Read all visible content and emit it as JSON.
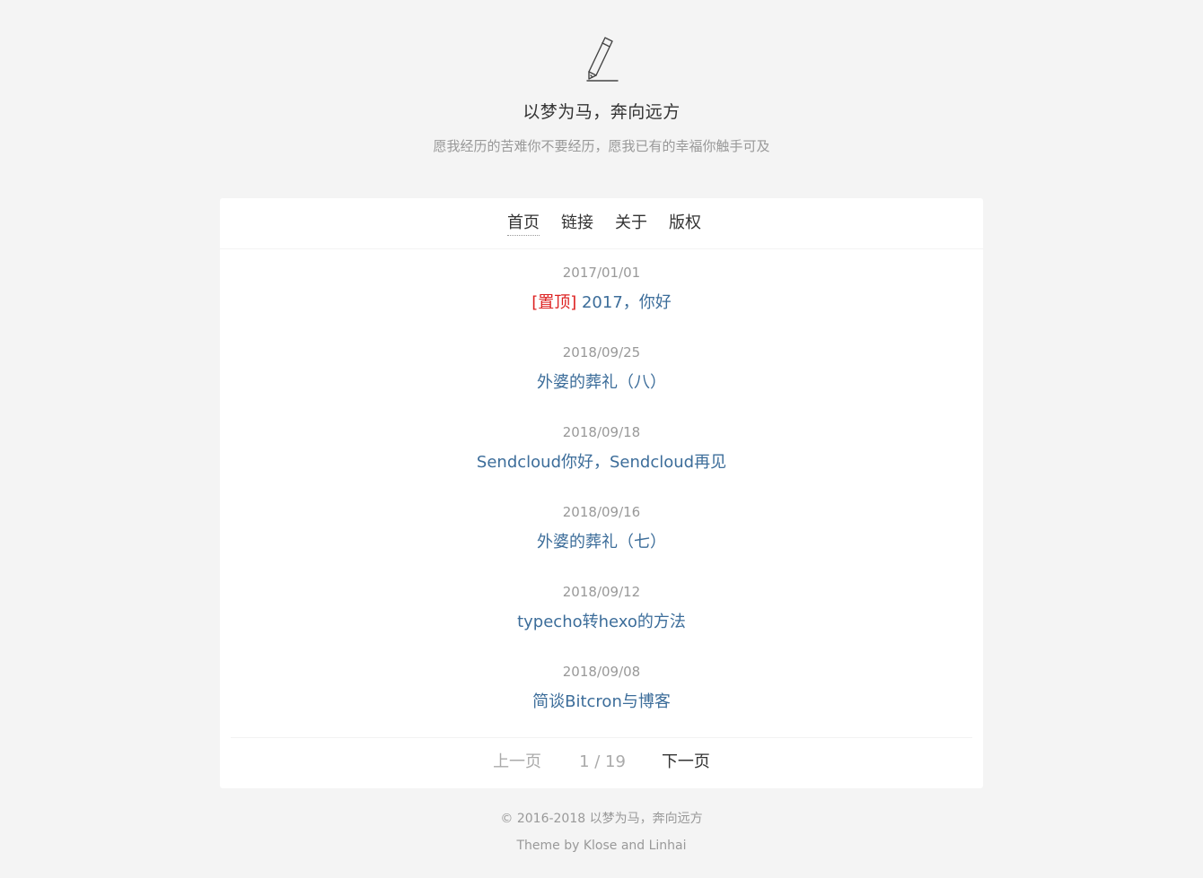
{
  "site": {
    "title": "以梦为马，奔向远方",
    "subtitle": "愿我经历的苦难你不要经历，愿我已有的幸福你触手可及"
  },
  "nav": {
    "items": [
      {
        "label": "首页",
        "active": true
      },
      {
        "label": "链接",
        "active": false
      },
      {
        "label": "关于",
        "active": false
      },
      {
        "label": "版权",
        "active": false
      }
    ]
  },
  "posts": [
    {
      "date": "2017/01/01",
      "pin": "[置顶]",
      "title": "2017，你好"
    },
    {
      "date": "2018/09/25",
      "pin": "",
      "title": "外婆的葬礼（八）"
    },
    {
      "date": "2018/09/18",
      "pin": "",
      "title": "Sendcloud你好，Sendcloud再见"
    },
    {
      "date": "2018/09/16",
      "pin": "",
      "title": "外婆的葬礼（七）"
    },
    {
      "date": "2018/09/12",
      "pin": "",
      "title": "typecho转hexo的方法"
    },
    {
      "date": "2018/09/08",
      "pin": "",
      "title": "简谈Bitcron与博客"
    }
  ],
  "pager": {
    "prev": "上一页",
    "page": "1 / 19",
    "next": "下一页"
  },
  "footer": {
    "copyright": "© 2016-2018 以梦为马，奔向远方",
    "theme": "Theme by Klose and Linhai"
  },
  "colors": {
    "background": "#f4f4f4",
    "link": "#3c6d9a",
    "pin": "#dd2222",
    "muted": "#999999"
  },
  "icons": {
    "logo": "pencil-icon"
  }
}
